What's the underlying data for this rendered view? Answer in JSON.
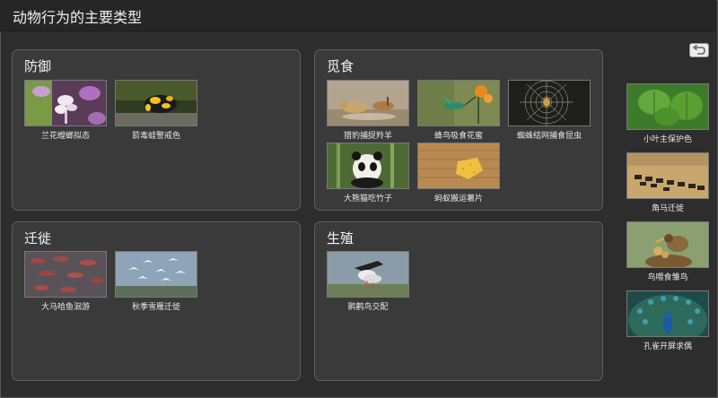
{
  "app": {
    "title": "动物行为的主要类型"
  },
  "toolbar": {
    "undo_icon": "undo-arrow-icon"
  },
  "categories": {
    "defense": {
      "title": "防御",
      "items": [
        {
          "label": "兰花螳螂拟态"
        },
        {
          "label": "箭毒蛙警戒色"
        }
      ]
    },
    "foraging": {
      "title": "觅食",
      "items": [
        {
          "label": "猎豹捕捉羚羊"
        },
        {
          "label": "蜂鸟吸食花蜜"
        },
        {
          "label": "蜘蛛结网捕食昆虫"
        },
        {
          "label": "大熊猫吃竹子"
        },
        {
          "label": "蚂蚁搬运薯片"
        }
      ]
    },
    "migration": {
      "title": "迁徙",
      "items": [
        {
          "label": "大马哈鱼洄游"
        },
        {
          "label": "秋季雪雁迁徙"
        }
      ]
    },
    "reproduction": {
      "title": "生殖",
      "items": [
        {
          "label": "鹮鹳鸟交配"
        }
      ]
    }
  },
  "unsorted": {
    "items": [
      {
        "label": "小叶主保护色"
      },
      {
        "label": "角马迁徙"
      },
      {
        "label": "鸟喂食雏鸟"
      },
      {
        "label": "孔雀开屏求偶"
      }
    ]
  }
}
